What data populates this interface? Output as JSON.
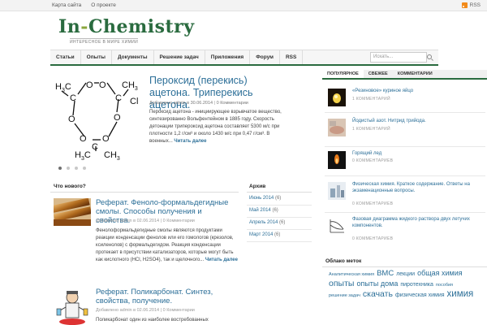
{
  "topbar": {
    "links": [
      "Карта сайта",
      "О проекте"
    ],
    "rss_label": "RSS"
  },
  "logo": {
    "title_part1": "In",
    "title_dash": "-",
    "title_part2": "Chemistry",
    "subtitle": "ИНТЕРЕСНОЕ В МИРЕ ХИМИИ"
  },
  "nav": {
    "items": [
      "Статьи",
      "Опыты",
      "Документы",
      "Решение задач",
      "Приложения",
      "Форум",
      "RSS"
    ],
    "search_placeholder": "Искать..."
  },
  "featured": {
    "title": "Пероксид (перекись) ацетона. Триперекись ацетона.",
    "meta_added": "Добавлено admin в 30.06.2014",
    "meta_comments": "0 Комментарии",
    "text": "Пероксид ацетона - инициирующее взрывчатое вещество, синтезированно Вольфентейном в 1885 году. Скорость детонации трипероксид ацетона составляет 5300 м/с при плотности 1,2 г/см³ и около 1430 м/с при 0,47 г/см³. В военных...",
    "read_more": "Читать далее",
    "dot_count": 4,
    "active_dot": 0,
    "molecule": {
      "atom_o": "O",
      "atom_c": "C",
      "group_h3": "H",
      "group_3": "3",
      "group_cl": "Cl"
    }
  },
  "new_posts": {
    "heading": "Что нового?",
    "posts": [
      {
        "title": "Реферат. Феноло-формальдегидные смолы. Способы получения и свойства.",
        "meta_added": "Добавлено admin в 02.06.2014",
        "meta_comments": "0 Комментарии",
        "text": "Фенолоформальдегидные смолы являются продуктами реакции конденсации фенолов или его гомологов (крезолов, ксиленолов) с формальдегидом. Реакция конденсации протекает в присутствии катализаторов, которые могут быть как кислотного (HCl, H2SO4), так и щелочного...",
        "read_more": "Читать далее"
      },
      {
        "title": "Реферат. Поликарбонат. Синтез, свойства, получение.",
        "meta_added": "Добавлено admin в 02.06.2014",
        "meta_comments": "0 Комментарии",
        "text": "Поликарбонат один из наиболее востребованных"
      }
    ]
  },
  "archive": {
    "heading": "Архив",
    "items": [
      {
        "label": "Июнь 2014",
        "count": "(6)"
      },
      {
        "label": "Май 2014",
        "count": "(6)"
      },
      {
        "label": "Апрель 2014",
        "count": "(6)"
      },
      {
        "label": "Март 2014",
        "count": "(6)"
      }
    ]
  },
  "sidebar": {
    "tabs": [
      "ПОПУЛЯРНОЕ",
      "СВЕЖЕЕ",
      "КОММЕНТАРИИ"
    ],
    "active_tab": 0,
    "popular": [
      {
        "title": "«Резиновое» куриное яйцо",
        "comments": "1 КОММЕНТАРИЙ"
      },
      {
        "title": "Йодистый азот. Нитрид трийода.",
        "comments": "1 КОММЕНТАРИЙ"
      },
      {
        "title": "Горящий лед",
        "comments": "0 КОММЕНТАРИЕВ"
      },
      {
        "title": "Физическая химия. Краткое содержание. Ответы на экзаменационные вопросы.",
        "comments": "0 КОММЕНТАРИЕВ"
      },
      {
        "title": "Фазовая диаграмма жидкого раствора двух летучих компонентов.",
        "comments": "0 КОММЕНТАРИЕВ"
      }
    ],
    "cloud_heading": "Облако меток",
    "tags": [
      {
        "label": "Аналитическая химия",
        "size": 5.5
      },
      {
        "label": "ВМС",
        "size": 9.5
      },
      {
        "label": "лекции",
        "size": 7
      },
      {
        "label": "общая химия",
        "size": 9
      },
      {
        "label": "опыты",
        "size": 10.5
      },
      {
        "label": "опыты дома",
        "size": 9
      },
      {
        "label": "пиротехника",
        "size": 7
      },
      {
        "label": "пособия",
        "size": 5.5
      },
      {
        "label": "решение задач",
        "size": 5.5
      },
      {
        "label": "скачать",
        "size": 10.5
      },
      {
        "label": "физическая химия",
        "size": 7
      },
      {
        "label": "химия",
        "size": 11.5
      }
    ]
  }
}
